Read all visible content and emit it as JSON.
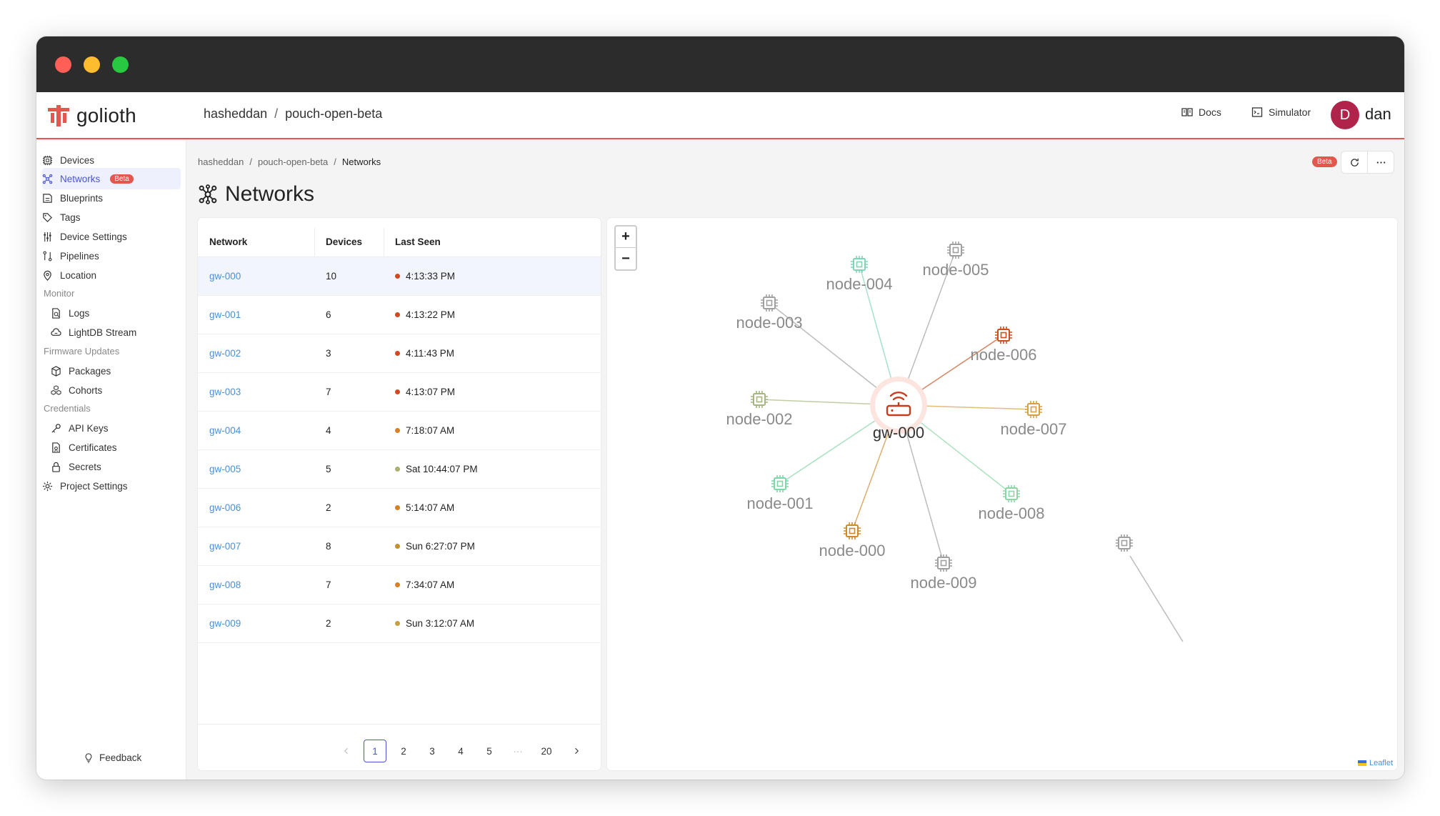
{
  "app": {
    "logo_text": "golioth",
    "project_owner": "hasheddan",
    "project_sep": "/",
    "project_name": "pouch-open-beta"
  },
  "topbar": {
    "docs_label": "Docs",
    "simulator_label": "Simulator",
    "avatar_initial": "D",
    "user_name": "dan"
  },
  "sidebar": {
    "items": [
      {
        "label": "Devices"
      },
      {
        "label": "Networks",
        "badge": "Beta"
      },
      {
        "label": "Blueprints"
      },
      {
        "label": "Tags"
      },
      {
        "label": "Device Settings"
      },
      {
        "label": "Pipelines"
      },
      {
        "label": "Location"
      }
    ],
    "monitor": {
      "title": "Monitor",
      "items": [
        {
          "label": "Logs"
        },
        {
          "label": "LightDB Stream"
        }
      ]
    },
    "firmware": {
      "title": "Firmware Updates",
      "items": [
        {
          "label": "Packages"
        },
        {
          "label": "Cohorts"
        }
      ]
    },
    "credentials": {
      "title": "Credentials",
      "items": [
        {
          "label": "API Keys"
        },
        {
          "label": "Certificates"
        },
        {
          "label": "Secrets"
        }
      ]
    },
    "project_settings": "Project Settings",
    "feedback": "Feedback"
  },
  "breadcrumb": {
    "owner": "hasheddan",
    "sep": "/",
    "project": "pouch-open-beta",
    "current": "Networks"
  },
  "header": {
    "beta_badge": "Beta",
    "title": "Networks"
  },
  "table": {
    "columns": [
      "Network",
      "Devices",
      "Last Seen"
    ],
    "rows": [
      {
        "network": "gw-000",
        "devices": "10",
        "last_seen": "4:13:33 PM",
        "status_color": "#d1491c"
      },
      {
        "network": "gw-001",
        "devices": "6",
        "last_seen": "4:13:22 PM",
        "status_color": "#d1491c"
      },
      {
        "network": "gw-002",
        "devices": "3",
        "last_seen": "4:11:43 PM",
        "status_color": "#d1491c"
      },
      {
        "network": "gw-003",
        "devices": "7",
        "last_seen": "4:13:07 PM",
        "status_color": "#d1491c"
      },
      {
        "network": "gw-004",
        "devices": "4",
        "last_seen": "7:18:07 AM",
        "status_color": "#d8801f"
      },
      {
        "network": "gw-005",
        "devices": "5",
        "last_seen": "Sat 10:44:07 PM",
        "status_color": "#a9b070"
      },
      {
        "network": "gw-006",
        "devices": "2",
        "last_seen": "5:14:07 AM",
        "status_color": "#d8801f"
      },
      {
        "network": "gw-007",
        "devices": "8",
        "last_seen": "Sun 6:27:07 PM",
        "status_color": "#c4902c"
      },
      {
        "network": "gw-008",
        "devices": "7",
        "last_seen": "7:34:07 AM",
        "status_color": "#d8801f"
      },
      {
        "network": "gw-009",
        "devices": "2",
        "last_seen": "Sun 3:12:07 AM",
        "status_color": "#c4a040"
      }
    ]
  },
  "pagination": {
    "pages": [
      "1",
      "2",
      "3",
      "4",
      "5",
      "···",
      "20"
    ],
    "current": "1"
  },
  "map": {
    "zoom_in": "+",
    "zoom_out": "−",
    "attribution": "Leaflet",
    "gateway": {
      "label": "gw-000",
      "color": "#c73c1f"
    },
    "nodes": [
      {
        "label": "node-000",
        "color": "#d08a2c"
      },
      {
        "label": "node-001",
        "color": "#7fd6a6"
      },
      {
        "label": "node-002",
        "color": "#a5b87a"
      },
      {
        "label": "node-003",
        "color": "#a0a0a0"
      },
      {
        "label": "node-004",
        "color": "#7fd6b4"
      },
      {
        "label": "node-005",
        "color": "#a0a0a0"
      },
      {
        "label": "node-006",
        "color": "#c8501e"
      },
      {
        "label": "node-007",
        "color": "#d8a040"
      },
      {
        "label": "node-008",
        "color": "#8cd6a4"
      },
      {
        "label": "node-009",
        "color": "#a0a0a0"
      },
      {
        "label": "",
        "color": "#a0a0a0"
      }
    ]
  },
  "colors": {
    "accent": "#4a55d4",
    "brand_red": "#e4574f",
    "link": "#4a90d9"
  }
}
